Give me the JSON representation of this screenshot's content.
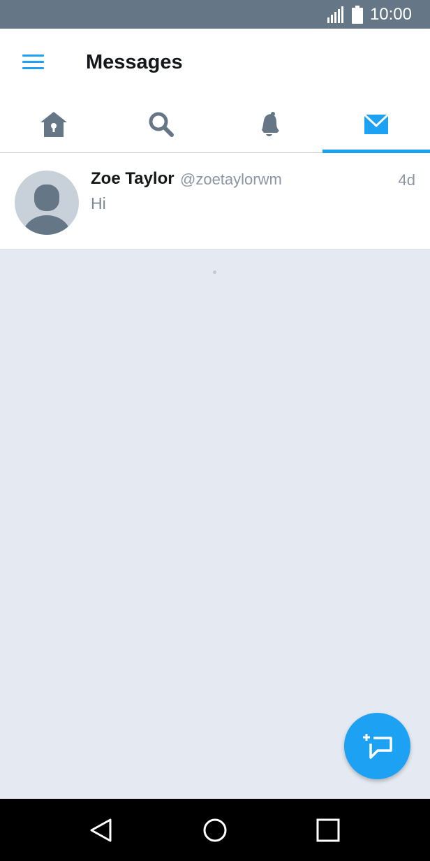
{
  "status_bar": {
    "time": "10:00"
  },
  "header": {
    "title": "Messages",
    "menu_icon": "hamburger-menu-icon"
  },
  "tabs": [
    {
      "id": "home",
      "icon": "home-icon",
      "active": false
    },
    {
      "id": "search",
      "icon": "search-icon",
      "active": false
    },
    {
      "id": "notifications",
      "icon": "bell-icon",
      "active": false
    },
    {
      "id": "messages",
      "icon": "envelope-icon",
      "active": true
    }
  ],
  "conversations": [
    {
      "name": "Zoe Taylor",
      "handle": "@zoetaylorwm",
      "time": "4d",
      "preview": "Hi"
    }
  ],
  "fab": {
    "icon": "new-message-icon"
  },
  "nav": {
    "back_icon": "back-triangle-icon",
    "home_icon": "home-circle-icon",
    "recents_icon": "recents-square-icon"
  },
  "colors": {
    "accent": "#1da1f2",
    "status_bar": "#657786",
    "icon_gray": "#657786",
    "background": "#e5eaf2"
  }
}
